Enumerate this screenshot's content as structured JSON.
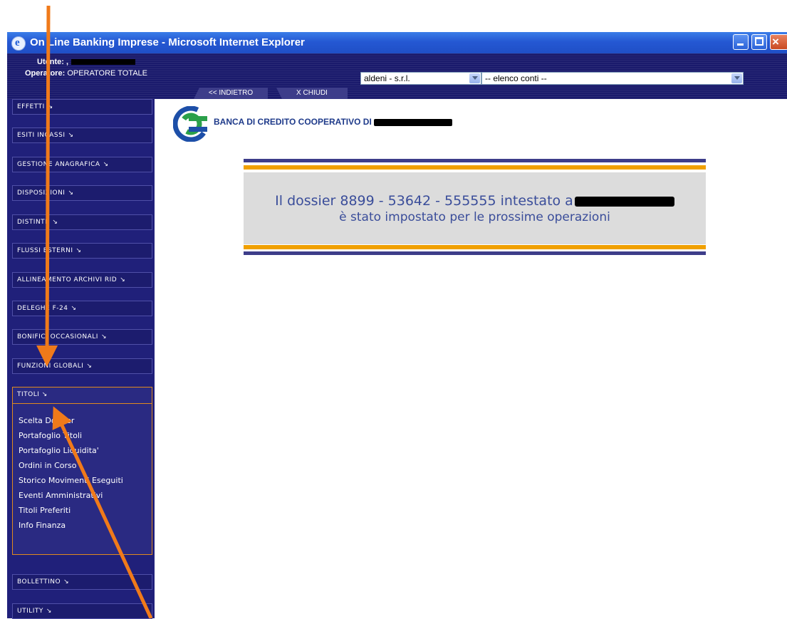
{
  "window": {
    "title": "On Line Banking Imprese - Microsoft Internet Explorer",
    "title_color": "#2558d3"
  },
  "header": {
    "user_label": "Utente: ,",
    "operator_label": "Operatore:",
    "operator_value": "OPERATORE TOTALE",
    "company_select": "aldeni - s.r.l.",
    "account_select": "-- elenco conti --",
    "back_label": "<< INDIETRO",
    "close_label": "X  CHIUDI"
  },
  "sidebar": {
    "items": [
      {
        "label": "EFFETTI"
      },
      {
        "label": "ESITI INCASSI"
      },
      {
        "label": "GESTIONE ANAGRAFICA"
      },
      {
        "label": "DISPOSIZIONI"
      },
      {
        "label": "DISTINTE"
      },
      {
        "label": "FLUSSI ESTERNI"
      },
      {
        "label": "ALLINEAMENTO ARCHIVI RID"
      },
      {
        "label": "DELEGHE F-24"
      },
      {
        "label": "BONIFICI OCCASIONALI"
      },
      {
        "label": "FUNZIONI GLOBALI"
      }
    ],
    "chevron": "↘",
    "titoli": {
      "label": "TITOLI",
      "subitems": [
        {
          "label": "Scelta Dossier"
        },
        {
          "label": "Portafoglio Titoli"
        },
        {
          "label": "Portafoglio Liquidita'"
        },
        {
          "label": "Ordini in Corso"
        },
        {
          "label": "Storico Movimenti Eseguiti"
        },
        {
          "label": "Eventi Amministrativi"
        },
        {
          "label": "Titoli Preferiti"
        },
        {
          "label": "Info Finanza"
        }
      ]
    },
    "bottom_items": [
      {
        "label": "BOLLETTINO"
      },
      {
        "label": "UTILITY"
      }
    ],
    "accent": "#e08a1e",
    "background": "#20207a"
  },
  "main": {
    "bank_name": "BANCA DI CREDITO COOPERATIVO DI",
    "message_line1": "Il dossier 8899 - 53642 - 555555 intestato a",
    "message_line2": "è stato impostato per le prossime operazioni",
    "bar_colors": [
      "#3d3d8a",
      "#f0a000"
    ]
  },
  "annotations": {
    "arrow_color": "#f07a1a"
  }
}
